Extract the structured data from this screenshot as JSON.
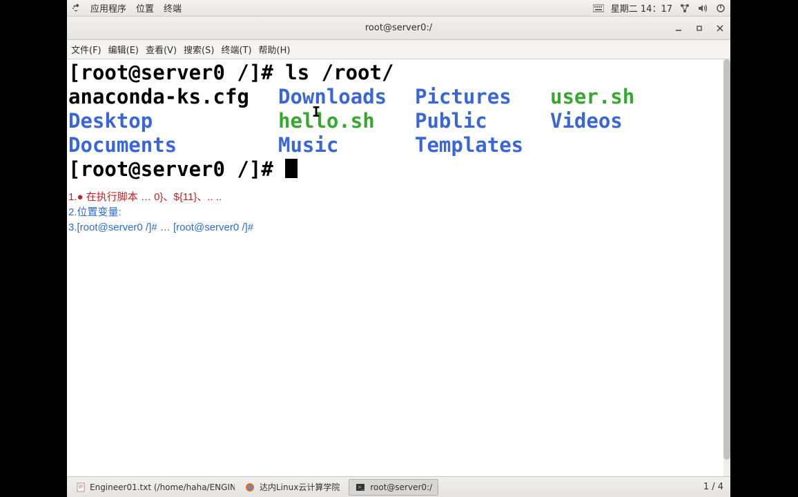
{
  "panel": {
    "apps": "应用程序",
    "places": "位置",
    "terminal": "终端",
    "datetime": "星期二 14：17"
  },
  "titlebar": {
    "title": "root@server0:/"
  },
  "menubar": {
    "file": "文件(F)",
    "edit": "编辑(E)",
    "view": "查看(V)",
    "search": "搜索(S)",
    "terminal": "终端(T)",
    "help": "帮助(H)"
  },
  "terminal": {
    "prompt1": "[root@server0 /]# ",
    "cmd1": "ls /root/",
    "ls": {
      "c1r1": "anaconda-ks.cfg",
      "c1r2": "Desktop",
      "c1r3": "Documents",
      "c2r1": "Downloads",
      "c2r2": "hello.sh",
      "c2r3": "Music",
      "c3r1": "Pictures",
      "c3r2": "Public",
      "c3r3": "Templates",
      "c4r1": "user.sh",
      "c4r2": "Videos"
    },
    "prompt2": "[root@server0 /]# "
  },
  "annotations": {
    "a1": "1.● 在执行脚本 … 0}、${11}、.. ..",
    "a2": "2.位置变量:",
    "a3": "3.[root@server0 /]#   …   [root@server0 /]#"
  },
  "taskbar": {
    "t1": "Engineer01.txt (/home/haha/ENGIN…",
    "t2": "达内Linux云计算学院",
    "t3": "root@server0:/",
    "pager": "1 / 4"
  }
}
